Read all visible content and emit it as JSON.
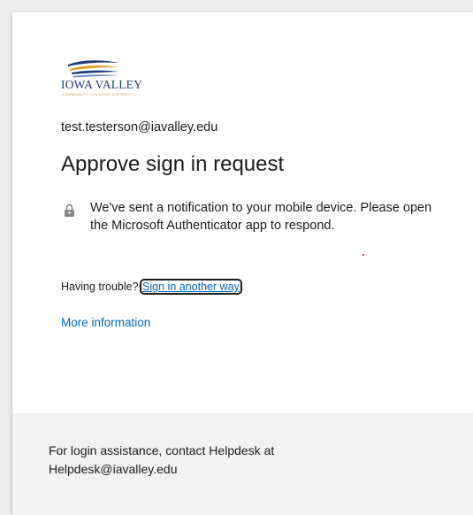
{
  "logo": {
    "name": "IOWA VALLEY",
    "tagline": "COMMUNITY COLLEGE DISTRICT"
  },
  "identity": {
    "email": "test.testerson@iavalley.edu"
  },
  "title": "Approve sign in request",
  "notice": {
    "icon": "lock-icon",
    "text": "We've sent a notification to your mobile device. Please open the Microsoft Authenticator app to respond."
  },
  "trouble": {
    "prefix": "Having trouble?",
    "link": "Sign in another way"
  },
  "more_info": "More information",
  "footer": {
    "text": "For login assistance, contact Helpdesk at Helpdesk@iavalley.edu"
  },
  "colors": {
    "link": "#0067b8",
    "text": "#1b1b1b",
    "footer_bg": "#f2f2f2",
    "logo_blue": "#1f3a7a",
    "logo_gold": "#c58a2a"
  }
}
